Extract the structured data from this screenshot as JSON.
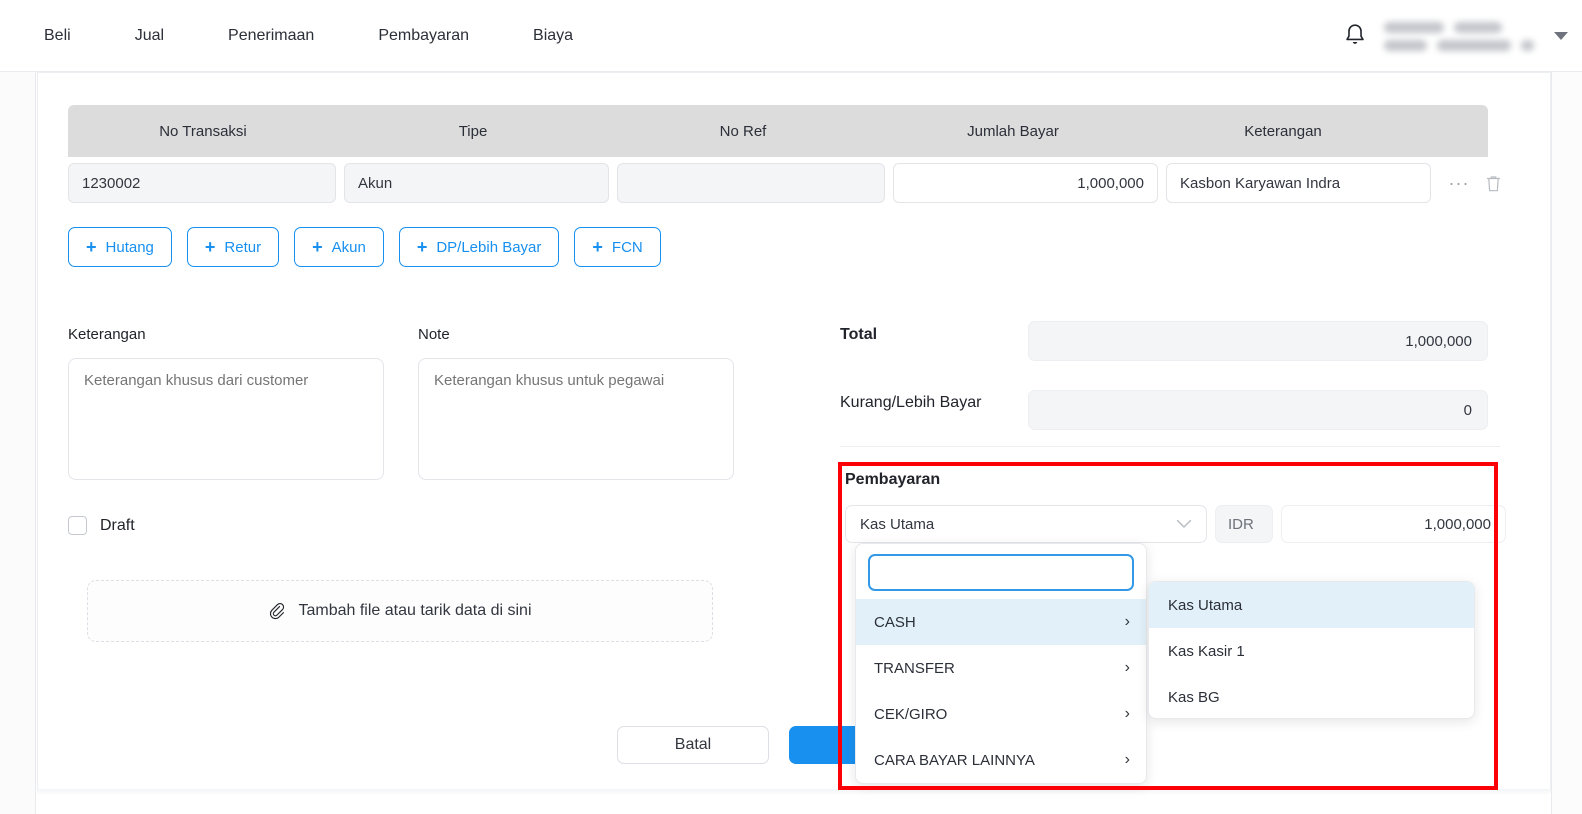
{
  "topnav": {
    "items": [
      {
        "label": "Beli"
      },
      {
        "label": "Jual"
      },
      {
        "label": "Penerimaan"
      },
      {
        "label": "Pembayaran"
      },
      {
        "label": "Biaya"
      }
    ],
    "bell_icon": "bell-icon",
    "caret_icon": "chevron-down-icon",
    "user_name_redacted": true
  },
  "grid": {
    "columns": [
      "No Transaksi",
      "Tipe",
      "No Ref",
      "Jumlah Bayar",
      "Keterangan"
    ],
    "rows": [
      {
        "no_transaksi": "1230002",
        "tipe": "Akun",
        "no_ref": "",
        "jumlah_bayar": "1,000,000",
        "keterangan": "Kasbon Karyawan Indra",
        "more_icon": "ellipsis-icon",
        "delete_icon": "trash-icon"
      }
    ]
  },
  "add_buttons": [
    {
      "label": "Hutang",
      "icon": "plus-icon"
    },
    {
      "label": "Retur",
      "icon": "plus-icon"
    },
    {
      "label": "Akun",
      "icon": "plus-icon"
    },
    {
      "label": "DP/Lebih Bayar",
      "icon": "plus-icon"
    },
    {
      "label": "FCN",
      "icon": "plus-icon"
    }
  ],
  "notes": {
    "keterangan_label": "Keterangan",
    "keterangan_placeholder": "Keterangan khusus dari customer",
    "keterangan_value": "",
    "note_label": "Note",
    "note_placeholder": "Keterangan khusus untuk pegawai",
    "note_value": ""
  },
  "draft": {
    "label": "Draft",
    "checked": false
  },
  "upload": {
    "label": "Tambah file atau tarik data di sini",
    "icon": "paperclip-icon"
  },
  "totals": {
    "total_label": "Total",
    "total_value": "1,000,000",
    "kurang_label": "Kurang/Lebih Bayar",
    "kurang_value": "0"
  },
  "payment": {
    "title": "Pembayaran",
    "selected_method": "Kas Utama",
    "chevron_icon": "chevron-down-icon",
    "currency": "IDR",
    "amount": "1,000,000",
    "dropdown": {
      "search_value": "",
      "search_placeholder": "",
      "items": [
        {
          "label": "CASH",
          "active": true,
          "arrow_icon": "chevron-right-icon"
        },
        {
          "label": "TRANSFER",
          "active": false,
          "arrow_icon": "chevron-right-icon"
        },
        {
          "label": "CEK/GIRO",
          "active": false,
          "arrow_icon": "chevron-right-icon"
        },
        {
          "label": "CARA BAYAR LAINNYA",
          "active": false,
          "arrow_icon": "chevron-right-icon"
        }
      ]
    },
    "submenu": {
      "items": [
        {
          "label": "Kas Utama",
          "active": true
        },
        {
          "label": "Kas Kasir 1",
          "active": false
        },
        {
          "label": "Kas BG",
          "active": false
        }
      ]
    }
  },
  "footer": {
    "cancel_label": "Batal",
    "submit_label": ""
  },
  "colors": {
    "accent": "#1890ef",
    "highlight_box": "#fb0007",
    "menu_active": "#e2f1f9",
    "header_bg": "#dcdcdc"
  }
}
